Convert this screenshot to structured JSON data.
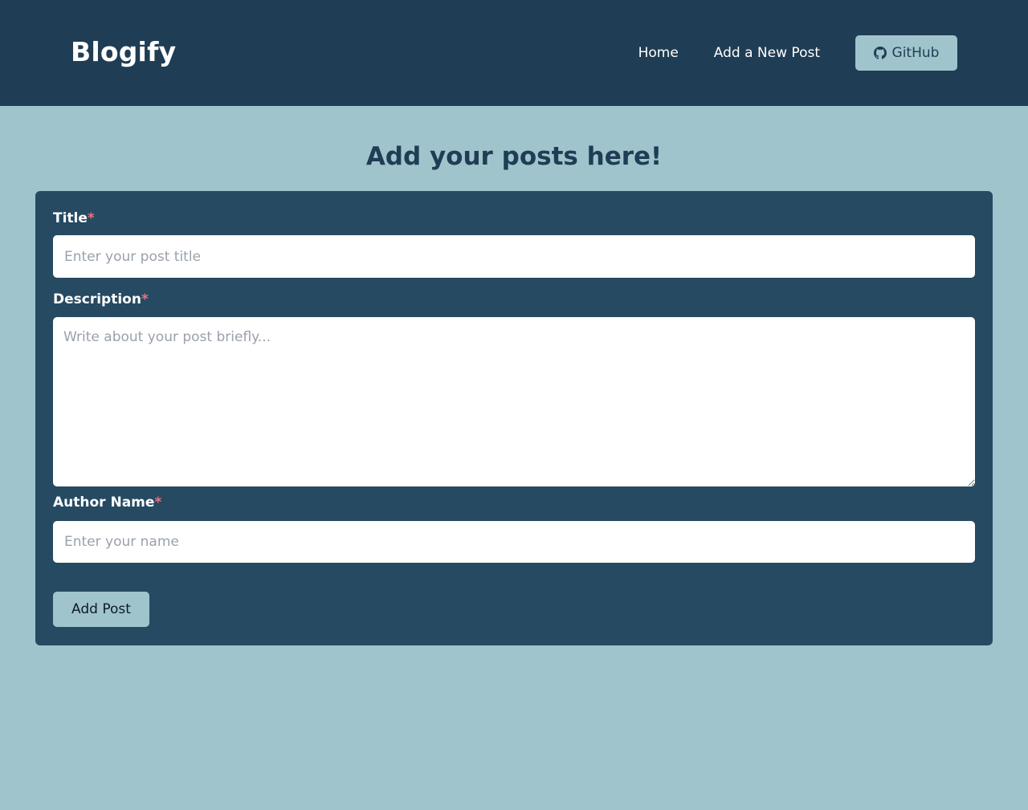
{
  "header": {
    "brand": "Blogify",
    "nav": {
      "home": "Home",
      "add_post": "Add a New Post",
      "github": "GitHub"
    }
  },
  "main": {
    "title": "Add your posts here!",
    "form": {
      "title_label": "Title",
      "title_placeholder": "Enter your post title",
      "description_label": "Description",
      "description_placeholder": "Write about your post briefly...",
      "author_label": "Author Name",
      "author_placeholder": "Enter your name",
      "required_mark": "*",
      "submit_label": "Add Post"
    }
  },
  "icons": {
    "github": "github-icon"
  },
  "colors": {
    "header_bg": "#1f3d54",
    "page_bg": "#a0c4cc",
    "card_bg": "#254a62",
    "accent": "#a0c4cc",
    "required": "#f07080"
  }
}
